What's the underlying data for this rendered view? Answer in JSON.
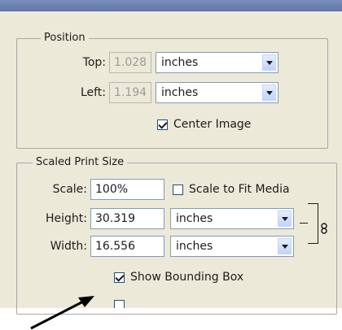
{
  "position": {
    "legend": "Position",
    "top_label": "Top:",
    "top_value": "1.028",
    "top_unit": "inches",
    "left_label": "Left:",
    "left_value": "1.194",
    "left_unit": "inches",
    "center_image_label": "Center Image",
    "center_image_checked": true
  },
  "scaled": {
    "legend": "Scaled Print Size",
    "scale_label": "Scale:",
    "scale_value": "100%",
    "fit_media_label": "Scale to Fit Media",
    "fit_media_checked": false,
    "height_label": "Height:",
    "height_value": "30.319",
    "height_unit": "inches",
    "width_label": "Width:",
    "width_value": "16.556",
    "width_unit": "inches",
    "bounding_box_label": "Show Bounding Box",
    "bounding_box_checked": true
  },
  "colors": {
    "titlebar": "#5f74a8",
    "panel": "#ece9d8",
    "input_border": "#7f9db9"
  }
}
